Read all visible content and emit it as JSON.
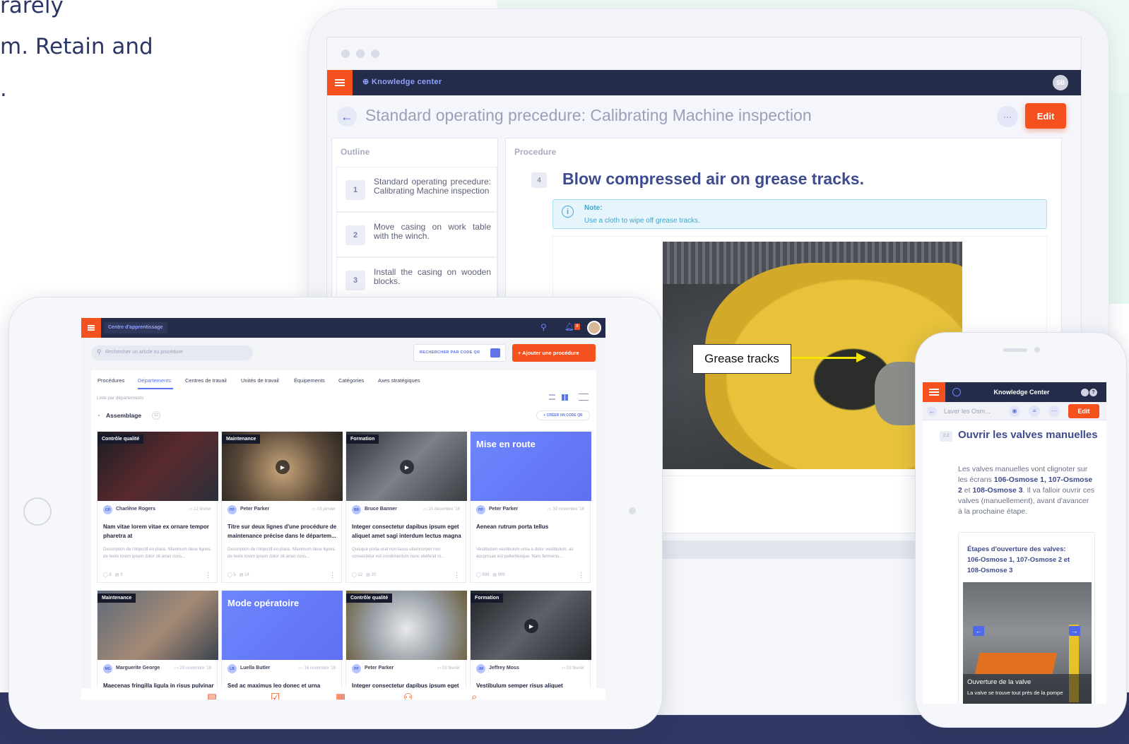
{
  "hero": {
    "line1": "rarely",
    "line2": "m. Retain and",
    "line3": "."
  },
  "desktop": {
    "app_name": "Knowledge center",
    "user_initials": "SB",
    "page_title": "Standard operating precedure: Calibrating Machine inspection",
    "more_label": "···",
    "edit_label": "Edit",
    "outline": {
      "heading": "Outline",
      "items": [
        {
          "num": "1",
          "text": "Standard operating precedure: Calibrating Machine inspection"
        },
        {
          "num": "2",
          "text": "Move casing on work table with the winch."
        },
        {
          "num": "3",
          "text": "Install the casing on wooden blocks."
        }
      ]
    },
    "procedure": {
      "heading": "Procedure",
      "step_num": "4",
      "step_title": "Blow compressed air on grease tracks.",
      "note_title": "Note:",
      "note_body": "Use a cloth to wipe off grease tracks.",
      "image_label": "Grease tracks"
    }
  },
  "tablet": {
    "app_name": "Centre d'apprentissage",
    "notification_count": "8",
    "search_placeholder": "Rechercher un article ou procédure",
    "qr_button": "RECHERCHER PAR CODE QR",
    "add_button": "+  Ajouter une procédure",
    "tabs": [
      "Procédures",
      "Départements",
      "Centres de travail",
      "Unités de travail",
      "Équipements",
      "Catégories",
      "Axes stratégiques"
    ],
    "active_tab": "Départements",
    "list_label": "Liste par départements",
    "group": {
      "name": "Assemblage",
      "count": "12",
      "create_qr": "+ CRÉER UN CODE QR"
    },
    "cards": [
      {
        "tag": "Contrôle qualité",
        "initials": "CR",
        "author": "Charlène Rogers",
        "date": "12 février",
        "title": "Nam vitae lorem vitae ex ornare tempor pharetra at",
        "desc": "Description de l'objectif en place. Maximum deux lignes de texte lorem ipsum dolor sit amet cons...",
        "comments": "8",
        "docs": "3",
        "video": false
      },
      {
        "tag": "Maintenance",
        "initials": "PP",
        "author": "Peter Parker",
        "date": "03 janvier",
        "title": "Titre sur deux lignes d'une procédure de maintenance précise dans le départem...",
        "desc": "Description de l'objectif en place. Maximum deux lignes de texte lorem ipsum dolor sit amet cons...",
        "comments": "5",
        "docs": "14",
        "video": true
      },
      {
        "tag": "Formation",
        "initials": "BB",
        "author": "Bruce Banner",
        "date": "15 décembre '18",
        "title": "Integer consectetur dapibus ipsum eget aliquet amet sagi interdum lectus magna",
        "desc": "Quisque porta erat non lacus ullamcorper non consectetur est condimentum nunc eleifend ni...",
        "comments": "12",
        "docs": "20",
        "video": true
      },
      {
        "tag": "Mise en route",
        "initials": "PP",
        "author": "Peter Parker",
        "date": "30 novembre '18",
        "title": "Aenean rutrum porta tellus",
        "desc": "Vestibulum vestibulum urna a dolor vestibulum, ac accumsan est pellentesque. Nam fermentu...",
        "comments": "999",
        "docs": "999",
        "video": false
      },
      {
        "tag": "Maintenance",
        "initials": "MG",
        "author": "Marguerite George",
        "date": "29 novembre '18",
        "title": "Maecenas fringilla ligula in risus pulvinar",
        "desc": "",
        "comments": "",
        "docs": "",
        "video": false
      },
      {
        "tag": "Mode opératoire",
        "initials": "LB",
        "author": "Luella Butler",
        "date": "16 novembre '18",
        "title": "Sed ac maximus leo donec et urna",
        "desc": "",
        "comments": "",
        "docs": "",
        "video": false
      },
      {
        "tag": "Contrôle qualité",
        "initials": "PP",
        "author": "Peter Parker",
        "date": "03 février",
        "title": "Integer consectetur dapibus ipsum eget",
        "desc": "",
        "comments": "",
        "docs": "",
        "video": false
      },
      {
        "tag": "Formation",
        "initials": "JM",
        "author": "Jeffrey Moss",
        "date": "03 février",
        "title": "Vestibulum semper risus aliquet",
        "desc": "",
        "comments": "",
        "docs": "",
        "video": true
      }
    ]
  },
  "phone": {
    "app_name": "Knowledge Center",
    "crumb": "Laver les Osm...",
    "edit_label": "Edit",
    "step_num": "2.3",
    "step_title": "Ouvrir les valves manuelles",
    "body_parts": [
      "Les valves manuelles vont clignoter sur les écrans ",
      "106-Osmose 1, 107-Osmose 2",
      " et ",
      "108-Osmose 3",
      ". Il va falloir ouvrir ces valves (manuellement), avant d'avancer à la prochaine étape."
    ],
    "card_title": "Étapes d'ouverture des valves: 106-Osmose 1, 107-Osmose 2 et 108-Osmose 3",
    "caption_title": "Ouverture de la valve",
    "caption_sub": "La valve se trouve tout près de la pompe"
  },
  "colors": {
    "accent": "#f4511e",
    "navy": "#252c4a",
    "primary": "#5a74f0",
    "heading": "#3e4c8e"
  }
}
